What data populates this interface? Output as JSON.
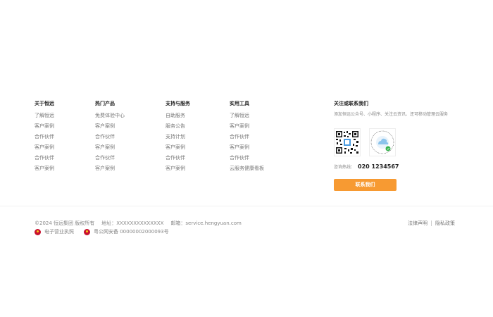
{
  "columns": [
    {
      "title": "关于恒远",
      "items": [
        "了解恒远",
        "客户案例",
        "合作伙伴",
        "客户案例",
        "合作伙伴",
        "客户案例"
      ]
    },
    {
      "title": "热门产品",
      "items": [
        "免费体验中心",
        "客户案例",
        "合作伙伴",
        "客户案例",
        "合作伙伴",
        "客户案例"
      ]
    },
    {
      "title": "支持与服务",
      "items": [
        "自助服务",
        "服务公告",
        "支持计划",
        "客户案例",
        "合作伙伴",
        "客户案例"
      ]
    },
    {
      "title": "实用工具",
      "items": [
        "了解恒远",
        "客户案例",
        "合作伙伴",
        "客户案例",
        "合作伙伴",
        "云服务健康看板"
      ]
    }
  ],
  "contact": {
    "title": "关注或联系我们",
    "description": "添加恒远公众号、小程序、关注云资讯、还可移动管理云服务",
    "hotline_label": "咨询热线：",
    "hotline_number": "020 1234567",
    "button_label": "联系我们"
  },
  "bottom": {
    "copyright": "©2024 恒远集团 版权所有",
    "address": "地址：XXXXXXXXXXXXXX",
    "email": "邮箱：service.hengyuan.com",
    "license": "电子营业执照",
    "police_record": "粤公网安备 00000002000093号",
    "legal_links": [
      "法律声明",
      "隐私政策"
    ]
  },
  "colors": {
    "accent": "#f79a32",
    "badge": "#c8102e"
  }
}
